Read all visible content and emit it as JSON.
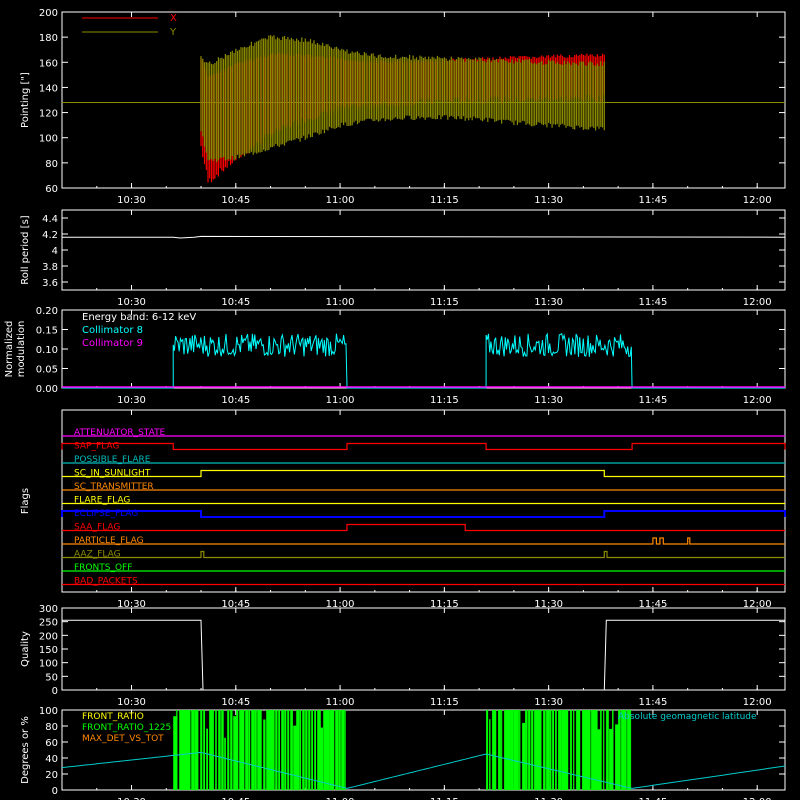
{
  "chart_data": [
    {
      "type": "line",
      "ylabel": "Pointing [\"]",
      "ylim": [
        60,
        200
      ],
      "yticks": [
        60,
        80,
        100,
        120,
        140,
        160,
        180,
        200
      ],
      "xticks": [
        "10:30",
        "10:45",
        "11:00",
        "11:15",
        "11:30",
        "11:45",
        "12:00"
      ],
      "xlim": [
        "10:20",
        "12:04"
      ],
      "legend": "top-left",
      "series": [
        {
          "name": "X",
          "color": "#ff0000",
          "x": [
            "10:40",
            "10:41",
            "10:45",
            "10:50",
            "10:55",
            "11:00",
            "11:05",
            "11:10",
            "11:15",
            "11:20",
            "11:25",
            "11:30",
            "11:35",
            "11:38"
          ],
          "upper": [
            165,
            150,
            160,
            168,
            167,
            164,
            162,
            162,
            163,
            164,
            165,
            166,
            167,
            167
          ],
          "lower": [
            90,
            62,
            80,
            100,
            112,
            120,
            123,
            125,
            126,
            127,
            127,
            128,
            128,
            128
          ]
        },
        {
          "name": "Y",
          "color": "#8c8c00",
          "x": [
            "10:40",
            "10:41",
            "10:45",
            "10:50",
            "10:55",
            "11:00",
            "11:05",
            "11:10",
            "11:15",
            "11:20",
            "11:25",
            "11:30",
            "11:35",
            "11:38"
          ],
          "upper": [
            165,
            160,
            172,
            182,
            180,
            172,
            167,
            166,
            165,
            164,
            163,
            162,
            161,
            161
          ],
          "lower": [
            105,
            80,
            82,
            90,
            98,
            108,
            112,
            114,
            114,
            113,
            110,
            108,
            106,
            105
          ],
          "baseline": 128
        }
      ]
    },
    {
      "type": "line",
      "ylabel": "Roll period [s]",
      "ylim": [
        3.5,
        4.5
      ],
      "yticks": [
        3.6,
        3.8,
        4.0,
        4.2,
        4.4
      ],
      "xticks": [
        "10:30",
        "10:45",
        "11:00",
        "11:15",
        "11:30",
        "11:45",
        "12:00"
      ],
      "series": [
        {
          "name": "",
          "color": "#ffffff",
          "x": [
            "10:20",
            "10:40",
            "12:04"
          ],
          "y": [
            4.16,
            4.16,
            4.16
          ]
        }
      ]
    },
    {
      "type": "line",
      "ylabel": "Normalized modulation",
      "ylim": [
        0,
        0.2
      ],
      "yticks": [
        "0.00",
        "0.05",
        "0.10",
        "0.15",
        "0.20"
      ],
      "xticks": [
        "10:30",
        "10:45",
        "11:00",
        "11:15",
        "11:30",
        "11:45",
        "12:00"
      ],
      "annotation": "Energy band: 6-12 keV",
      "series": [
        {
          "name": "Collimator 8",
          "color": "#00ffff",
          "segments": [
            {
              "start": "10:36",
              "end": "11:01",
              "mean": 0.11
            },
            {
              "start": "11:21",
              "end": "11:42",
              "mean": 0.11
            }
          ]
        },
        {
          "name": "Collimator 9",
          "color": "#ff00ff",
          "y": 0
        }
      ]
    },
    {
      "type": "line",
      "ylabel": "Flags",
      "xticks": [
        "10:30",
        "10:45",
        "11:00",
        "11:15",
        "11:30",
        "11:45",
        "12:00"
      ],
      "flags": [
        {
          "name": "ATTENUATOR_STATE",
          "color": "#ff00ff",
          "high": []
        },
        {
          "name": "SAP_FLAG",
          "color": "#ff0000",
          "high": [
            [
              "10:20",
              "10:36"
            ],
            [
              "11:01",
              "11:21"
            ],
            [
              "11:42",
              "12:04"
            ]
          ]
        },
        {
          "name": "POSSIBLE_FLARE",
          "color": "#00bbbb",
          "high": []
        },
        {
          "name": "SC_IN_SUNLIGHT",
          "color": "#ffff00",
          "high": [
            [
              "10:40",
              "11:38"
            ]
          ]
        },
        {
          "name": "SC_TRANSMITTER",
          "color": "#ff8800",
          "high": []
        },
        {
          "name": "FLARE_FLAG",
          "color": "#ffff00",
          "high": []
        },
        {
          "name": "ECLIPSE_FLAG",
          "color": "#0000ff",
          "high": [
            [
              "10:20",
              "10:40"
            ],
            [
              "11:38",
              "12:04"
            ]
          ]
        },
        {
          "name": "SAA_FLAG",
          "color": "#ff0000",
          "high": [
            [
              "11:01",
              "11:18"
            ]
          ]
        },
        {
          "name": "PARTICLE_FLAG",
          "color": "#ff8800",
          "high": [
            [
              "11:45",
              "11:45.5"
            ],
            [
              "11:46",
              "11:46.5"
            ],
            [
              "11:50",
              "11:50.3"
            ]
          ]
        },
        {
          "name": "AAZ_FLAG",
          "color": "#8c8c00",
          "high": [
            [
              "10:40",
              "10:40.4"
            ],
            [
              "11:38",
              "11:38.4"
            ]
          ]
        },
        {
          "name": "FRONTS_OFF",
          "color": "#00ff00",
          "high": []
        },
        {
          "name": "BAD_PACKETS",
          "color": "#ff0000",
          "high": []
        }
      ]
    },
    {
      "type": "line",
      "ylabel": "Quality",
      "ylim": [
        0,
        300
      ],
      "yticks": [
        0,
        50,
        100,
        150,
        200,
        250,
        300
      ],
      "xticks": [
        "10:30",
        "10:45",
        "11:00",
        "11:15",
        "11:30",
        "11:45",
        "12:00"
      ],
      "series": [
        {
          "name": "",
          "color": "#ffffff",
          "x": [
            "10:20",
            "10:40",
            "10:40.3",
            "11:38",
            "11:38.3",
            "12:04"
          ],
          "y": [
            255,
            255,
            0,
            0,
            255,
            255
          ]
        }
      ]
    },
    {
      "type": "area",
      "ylabel": "Degrees or %",
      "ylim": [
        0,
        100
      ],
      "yticks": [
        0,
        20,
        40,
        60,
        80,
        100
      ],
      "xticks": [
        "10:30",
        "10:45",
        "11:00",
        "11:15",
        "11:30",
        "11:45",
        "12:00"
      ],
      "legend": "top-left",
      "series": [
        {
          "name": "FRONT_RATIO",
          "color": "#ffff00"
        },
        {
          "name": "FRONT_RATIO_1225",
          "color": "#00ff00",
          "segments": [
            {
              "start": "10:36",
              "end": "11:01"
            },
            {
              "start": "11:21",
              "end": "11:42"
            }
          ]
        },
        {
          "name": "MAX_DET_VS_TOT",
          "color": "#ff8800"
        },
        {
          "name": "Absolute geomagnetic latitude",
          "color": "#00cccc",
          "x": [
            "10:20",
            "10:40",
            "11:01",
            "11:21",
            "11:42",
            "12:04"
          ],
          "y": [
            28,
            47,
            2,
            45,
            2,
            30
          ]
        }
      ]
    }
  ]
}
